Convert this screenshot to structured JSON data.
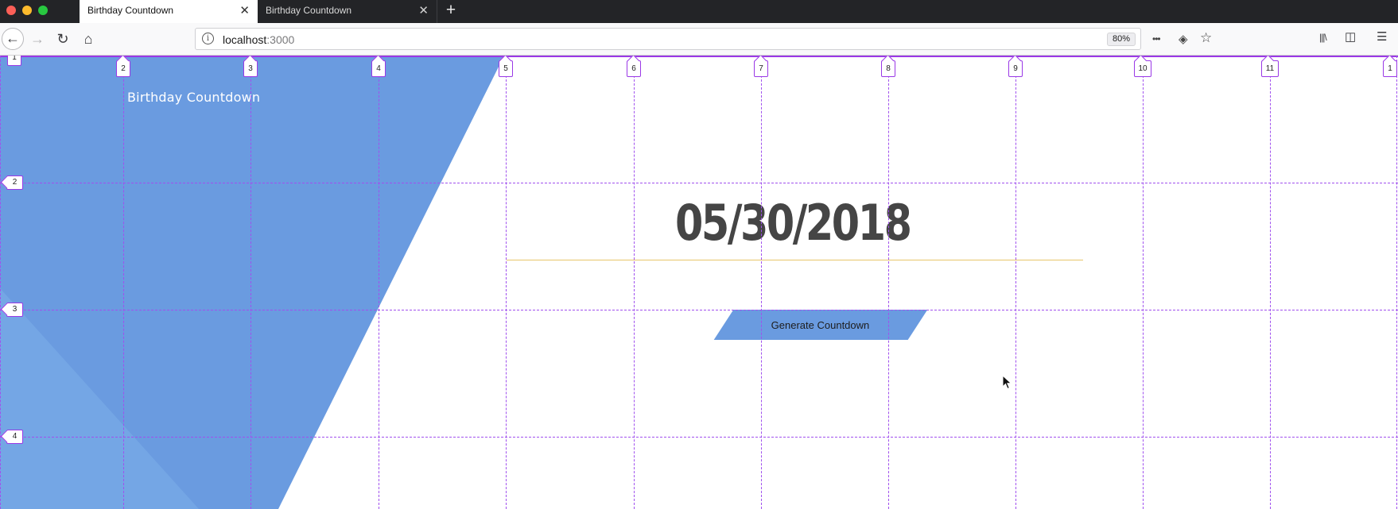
{
  "browser": {
    "tabs": [
      {
        "title": "Birthday Countdown",
        "active": true
      },
      {
        "title": "Birthday Countdown",
        "active": false
      }
    ],
    "tab_close_glyph": "✕",
    "new_tab_glyph": "+",
    "address": {
      "host": "localhost",
      "port": ":3000"
    },
    "zoom": "80%",
    "page_actions": {
      "more": "•••",
      "pocket": "◈",
      "bookmark": "☆"
    },
    "toolbar": {
      "library": "|||\\",
      "sidebar": "◫",
      "menu": "☰"
    },
    "nav": {
      "back": "←",
      "forward": "→",
      "reload": "↻",
      "home": "⌂"
    },
    "info_glyph": "i"
  },
  "page": {
    "brand": "Birthday Countdown",
    "date": "05/30/2018",
    "button_label": "Generate Countdown"
  },
  "grid": {
    "columns": [
      "1",
      "2",
      "3",
      "4",
      "5",
      "6",
      "7",
      "8",
      "9",
      "10",
      "11",
      "1"
    ],
    "rows": [
      "2",
      "3",
      "4"
    ]
  },
  "colors": {
    "hero_blue": "#6a9be0",
    "grid_purple": "#9a38e6",
    "accent_line": "#e8c56a",
    "date_text": "#454545"
  }
}
